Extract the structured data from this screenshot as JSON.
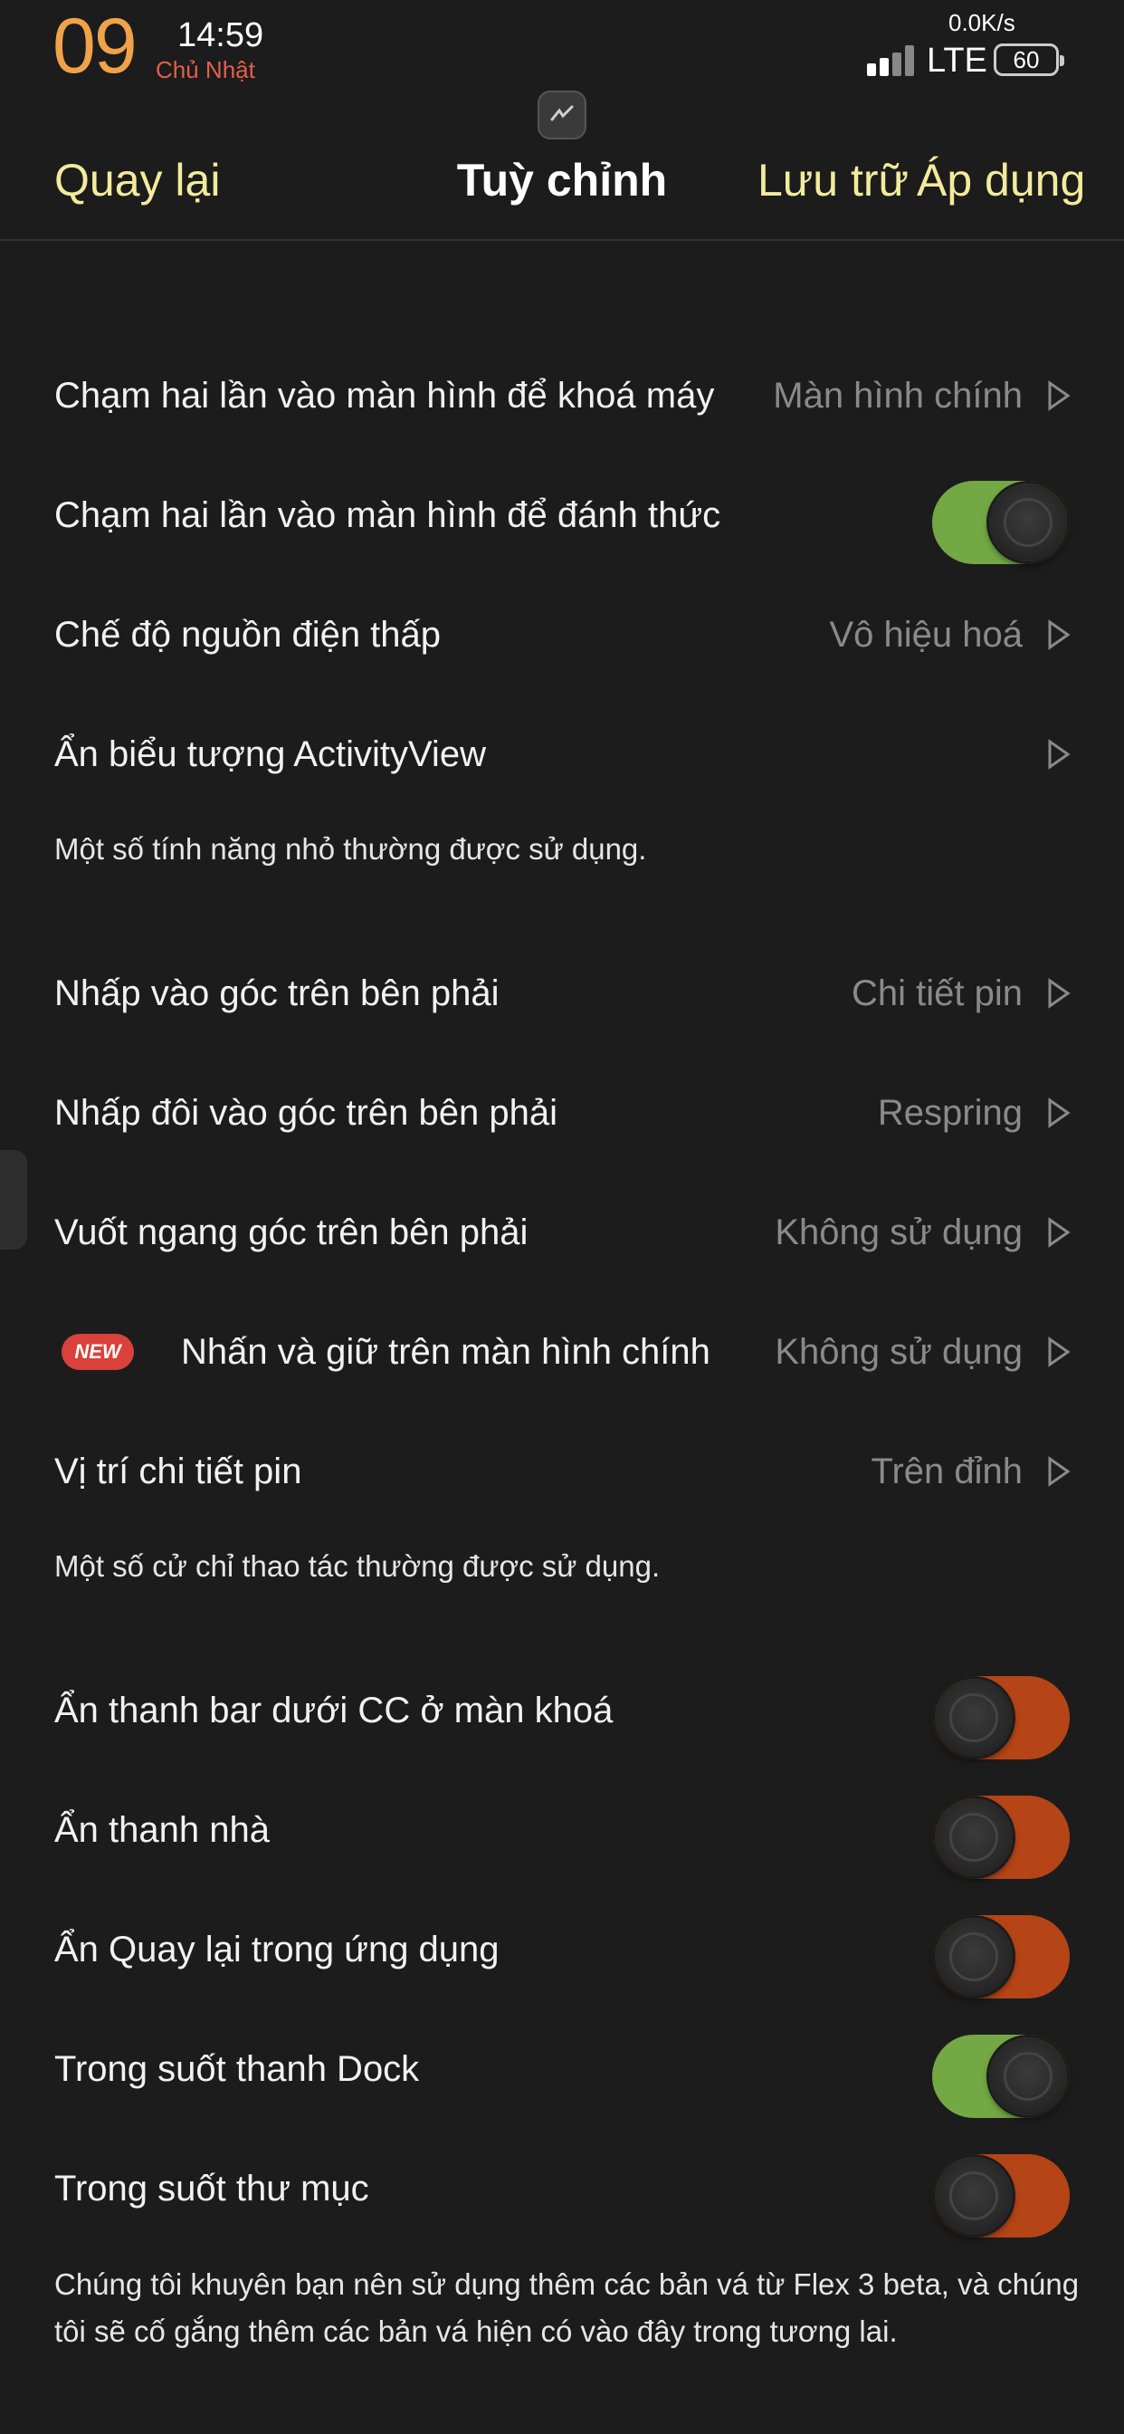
{
  "status_bar": {
    "day": "09",
    "time": "14:59",
    "weekday": "Chủ Nhật",
    "net_speed": "0.0K/s",
    "network": "LTE",
    "battery": "60"
  },
  "nav": {
    "back": "Quay lại",
    "title": "Tuỳ chỉnh",
    "save": "Lưu trữ",
    "apply": "Áp dụng"
  },
  "section1": {
    "rows": [
      {
        "label": "Chạm hai lần vào màn hình để khoá máy",
        "value": "Màn hình chính"
      },
      {
        "label": "Chạm hai lần vào màn hình để đánh thức",
        "toggle": "on"
      },
      {
        "label": "Chế độ nguồn điện thấp",
        "value": "Vô hiệu hoá"
      },
      {
        "label": "Ẩn biểu tượng ActivityView",
        "value": ""
      }
    ],
    "note": "Một số tính năng nhỏ thường được sử dụng."
  },
  "section2": {
    "rows": [
      {
        "label": "Nhấp vào góc trên bên phải",
        "value": "Chi tiết pin"
      },
      {
        "label": "Nhấp đôi vào góc trên bên phải",
        "value": "Respring"
      },
      {
        "label": "Vuốt ngang góc trên bên phải",
        "value": "Không sử dụng"
      },
      {
        "label": "Nhấn và giữ trên màn hình chính",
        "value": "Không sử dụng",
        "badge": "NEW"
      },
      {
        "label": "Vị trí chi tiết pin",
        "value": "Trên đỉnh"
      }
    ],
    "note": "Một số cử chỉ thao tác thường được sử dụng."
  },
  "section3": {
    "rows": [
      {
        "label": "Ẩn thanh bar dưới CC ở màn khoá",
        "toggle": "off"
      },
      {
        "label": "Ẩn thanh nhà",
        "toggle": "off"
      },
      {
        "label": "Ẩn Quay lại trong ứng dụng",
        "toggle": "off"
      },
      {
        "label": "Trong suốt thanh Dock",
        "toggle": "on"
      },
      {
        "label": "Trong suốt thư mục",
        "toggle": "off"
      }
    ],
    "note_line1": "Chúng tôi khuyên bạn nên sử dụng thêm các bản vá từ Flex 3 beta, và chúng",
    "note_line2": "tôi sẽ cố gắng thêm các bản vá hiện có vào đây trong tương lai."
  },
  "colors": {
    "accent_nav": "#f3eb9c",
    "toggle_on": "#73a844",
    "toggle_off": "#b54517",
    "day_orange": "#f0a24a",
    "badge_red": "#d9413a"
  }
}
